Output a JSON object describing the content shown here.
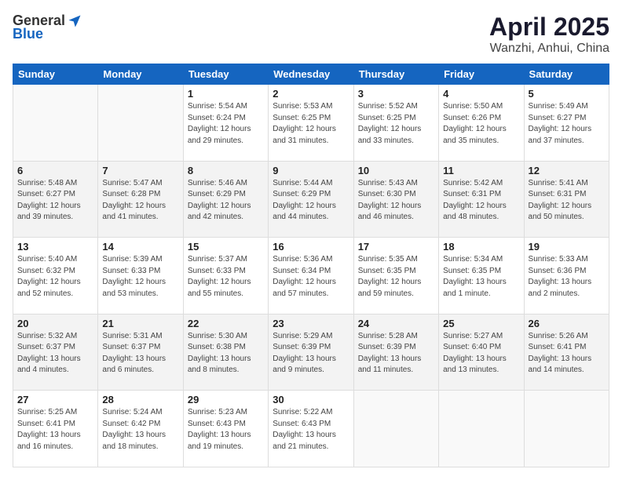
{
  "header": {
    "logo_general": "General",
    "logo_blue": "Blue",
    "month": "April 2025",
    "location": "Wanzhi, Anhui, China"
  },
  "weekdays": [
    "Sunday",
    "Monday",
    "Tuesday",
    "Wednesday",
    "Thursday",
    "Friday",
    "Saturday"
  ],
  "rows": [
    [
      {
        "num": "",
        "info": ""
      },
      {
        "num": "",
        "info": ""
      },
      {
        "num": "1",
        "info": "Sunrise: 5:54 AM\nSunset: 6:24 PM\nDaylight: 12 hours\nand 29 minutes."
      },
      {
        "num": "2",
        "info": "Sunrise: 5:53 AM\nSunset: 6:25 PM\nDaylight: 12 hours\nand 31 minutes."
      },
      {
        "num": "3",
        "info": "Sunrise: 5:52 AM\nSunset: 6:25 PM\nDaylight: 12 hours\nand 33 minutes."
      },
      {
        "num": "4",
        "info": "Sunrise: 5:50 AM\nSunset: 6:26 PM\nDaylight: 12 hours\nand 35 minutes."
      },
      {
        "num": "5",
        "info": "Sunrise: 5:49 AM\nSunset: 6:27 PM\nDaylight: 12 hours\nand 37 minutes."
      }
    ],
    [
      {
        "num": "6",
        "info": "Sunrise: 5:48 AM\nSunset: 6:27 PM\nDaylight: 12 hours\nand 39 minutes."
      },
      {
        "num": "7",
        "info": "Sunrise: 5:47 AM\nSunset: 6:28 PM\nDaylight: 12 hours\nand 41 minutes."
      },
      {
        "num": "8",
        "info": "Sunrise: 5:46 AM\nSunset: 6:29 PM\nDaylight: 12 hours\nand 42 minutes."
      },
      {
        "num": "9",
        "info": "Sunrise: 5:44 AM\nSunset: 6:29 PM\nDaylight: 12 hours\nand 44 minutes."
      },
      {
        "num": "10",
        "info": "Sunrise: 5:43 AM\nSunset: 6:30 PM\nDaylight: 12 hours\nand 46 minutes."
      },
      {
        "num": "11",
        "info": "Sunrise: 5:42 AM\nSunset: 6:31 PM\nDaylight: 12 hours\nand 48 minutes."
      },
      {
        "num": "12",
        "info": "Sunrise: 5:41 AM\nSunset: 6:31 PM\nDaylight: 12 hours\nand 50 minutes."
      }
    ],
    [
      {
        "num": "13",
        "info": "Sunrise: 5:40 AM\nSunset: 6:32 PM\nDaylight: 12 hours\nand 52 minutes."
      },
      {
        "num": "14",
        "info": "Sunrise: 5:39 AM\nSunset: 6:33 PM\nDaylight: 12 hours\nand 53 minutes."
      },
      {
        "num": "15",
        "info": "Sunrise: 5:37 AM\nSunset: 6:33 PM\nDaylight: 12 hours\nand 55 minutes."
      },
      {
        "num": "16",
        "info": "Sunrise: 5:36 AM\nSunset: 6:34 PM\nDaylight: 12 hours\nand 57 minutes."
      },
      {
        "num": "17",
        "info": "Sunrise: 5:35 AM\nSunset: 6:35 PM\nDaylight: 12 hours\nand 59 minutes."
      },
      {
        "num": "18",
        "info": "Sunrise: 5:34 AM\nSunset: 6:35 PM\nDaylight: 13 hours\nand 1 minute."
      },
      {
        "num": "19",
        "info": "Sunrise: 5:33 AM\nSunset: 6:36 PM\nDaylight: 13 hours\nand 2 minutes."
      }
    ],
    [
      {
        "num": "20",
        "info": "Sunrise: 5:32 AM\nSunset: 6:37 PM\nDaylight: 13 hours\nand 4 minutes."
      },
      {
        "num": "21",
        "info": "Sunrise: 5:31 AM\nSunset: 6:37 PM\nDaylight: 13 hours\nand 6 minutes."
      },
      {
        "num": "22",
        "info": "Sunrise: 5:30 AM\nSunset: 6:38 PM\nDaylight: 13 hours\nand 8 minutes."
      },
      {
        "num": "23",
        "info": "Sunrise: 5:29 AM\nSunset: 6:39 PM\nDaylight: 13 hours\nand 9 minutes."
      },
      {
        "num": "24",
        "info": "Sunrise: 5:28 AM\nSunset: 6:39 PM\nDaylight: 13 hours\nand 11 minutes."
      },
      {
        "num": "25",
        "info": "Sunrise: 5:27 AM\nSunset: 6:40 PM\nDaylight: 13 hours\nand 13 minutes."
      },
      {
        "num": "26",
        "info": "Sunrise: 5:26 AM\nSunset: 6:41 PM\nDaylight: 13 hours\nand 14 minutes."
      }
    ],
    [
      {
        "num": "27",
        "info": "Sunrise: 5:25 AM\nSunset: 6:41 PM\nDaylight: 13 hours\nand 16 minutes."
      },
      {
        "num": "28",
        "info": "Sunrise: 5:24 AM\nSunset: 6:42 PM\nDaylight: 13 hours\nand 18 minutes."
      },
      {
        "num": "29",
        "info": "Sunrise: 5:23 AM\nSunset: 6:43 PM\nDaylight: 13 hours\nand 19 minutes."
      },
      {
        "num": "30",
        "info": "Sunrise: 5:22 AM\nSunset: 6:43 PM\nDaylight: 13 hours\nand 21 minutes."
      },
      {
        "num": "",
        "info": ""
      },
      {
        "num": "",
        "info": ""
      },
      {
        "num": "",
        "info": ""
      }
    ]
  ]
}
